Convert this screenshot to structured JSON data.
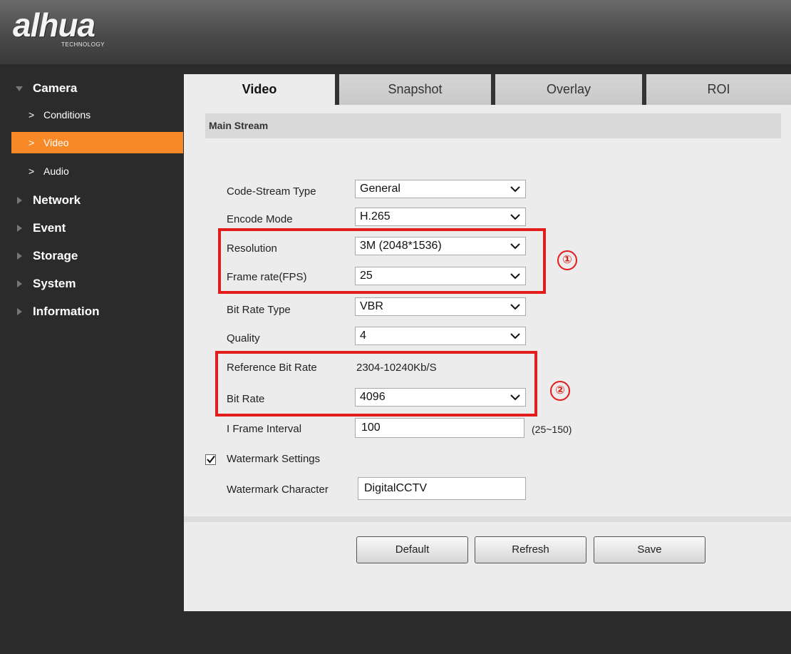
{
  "brand": {
    "logo": "alhua",
    "tagline": "TECHNOLOGY"
  },
  "sidebar": {
    "sections": [
      {
        "label": "Camera",
        "expanded": true
      },
      {
        "label": "Network",
        "expanded": false
      },
      {
        "label": "Event",
        "expanded": false
      },
      {
        "label": "Storage",
        "expanded": false
      },
      {
        "label": "System",
        "expanded": false
      },
      {
        "label": "Information",
        "expanded": false
      }
    ],
    "camera_items": [
      {
        "label": "Conditions",
        "active": false
      },
      {
        "label": "Video",
        "active": true
      },
      {
        "label": "Audio",
        "active": false
      }
    ],
    "chevron": ">",
    "active_color": "#f78a26"
  },
  "tabs": [
    {
      "label": "Video",
      "active": true
    },
    {
      "label": "Snapshot",
      "active": false
    },
    {
      "label": "Overlay",
      "active": false
    },
    {
      "label": "ROI",
      "active": false
    }
  ],
  "section_title": "Main Stream",
  "form": {
    "code_stream_type": {
      "label": "Code-Stream Type",
      "value": "General"
    },
    "encode_mode": {
      "label": "Encode Mode",
      "value": "H.265"
    },
    "resolution": {
      "label": "Resolution",
      "value": "3M (2048*1536)"
    },
    "frame_rate": {
      "label": "Frame rate(FPS)",
      "value": "25"
    },
    "bit_rate_type": {
      "label": "Bit Rate Type",
      "value": "VBR"
    },
    "quality": {
      "label": "Quality",
      "value": "4"
    },
    "reference_bit_rate": {
      "label": "Reference Bit Rate",
      "value": "2304-10240Kb/S"
    },
    "bit_rate": {
      "label": "Bit Rate",
      "value": "4096"
    },
    "i_frame_interval": {
      "label": "I Frame Interval",
      "value": "100",
      "range_hint": "(25~150)"
    },
    "watermark_settings": {
      "label": "Watermark Settings",
      "checked": true
    },
    "watermark_character": {
      "label": "Watermark Character",
      "value": "DigitalCCTV"
    }
  },
  "buttons": {
    "default": "Default",
    "refresh": "Refresh",
    "save": "Save"
  },
  "callouts": [
    {
      "number": "①",
      "covers": [
        "Resolution",
        "Frame rate(FPS)"
      ]
    },
    {
      "number": "②",
      "covers": [
        "Reference Bit Rate",
        "Bit Rate"
      ]
    }
  ],
  "colors": {
    "callout_red": "#e21b1b",
    "sidebar_bg": "#2b2b2b",
    "panel_bg": "#ececec"
  }
}
